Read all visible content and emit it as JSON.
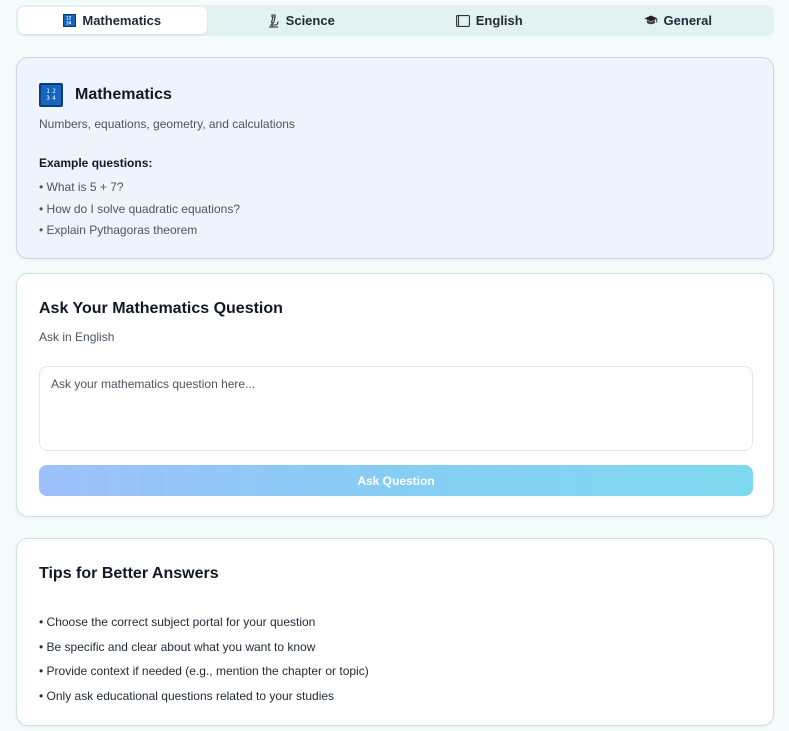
{
  "tabs": [
    {
      "label": "Mathematics",
      "icon": "numbers-icon",
      "active": true
    },
    {
      "label": "Science",
      "icon": "microscope-icon",
      "active": false
    },
    {
      "label": "English",
      "icon": "book-icon",
      "active": false
    },
    {
      "label": "General",
      "icon": "graduation-cap-icon",
      "active": false
    }
  ],
  "subject": {
    "title": "Mathematics",
    "icon_digits": [
      "1",
      "2",
      "3",
      "4"
    ],
    "description": "Numbers, equations, geometry, and calculations",
    "examples_heading": "Example questions:",
    "examples": [
      "• What is 5 + 7?",
      "• How do I solve quadratic equations?",
      "• Explain Pythagoras theorem"
    ]
  },
  "ask": {
    "title": "Ask Your Mathematics Question",
    "subtitle": "Ask in English",
    "placeholder": "Ask your mathematics question here...",
    "value": "",
    "button_label": "Ask Question"
  },
  "tips": {
    "title": "Tips for Better Answers",
    "items": [
      "• Choose the correct subject portal for your question",
      "• Be specific and clear about what you want to know",
      "• Provide context if needed (e.g., mention the chapter or topic)",
      "• Only ask educational questions related to your studies"
    ]
  },
  "colors": {
    "page_bg": "#f3fbfb",
    "tab_bar_bg": "#e2f2f2",
    "info_card_bg": "#edf4fc",
    "button_gradient_start": "#9ec0fa",
    "button_gradient_end": "#7fd9ee"
  }
}
